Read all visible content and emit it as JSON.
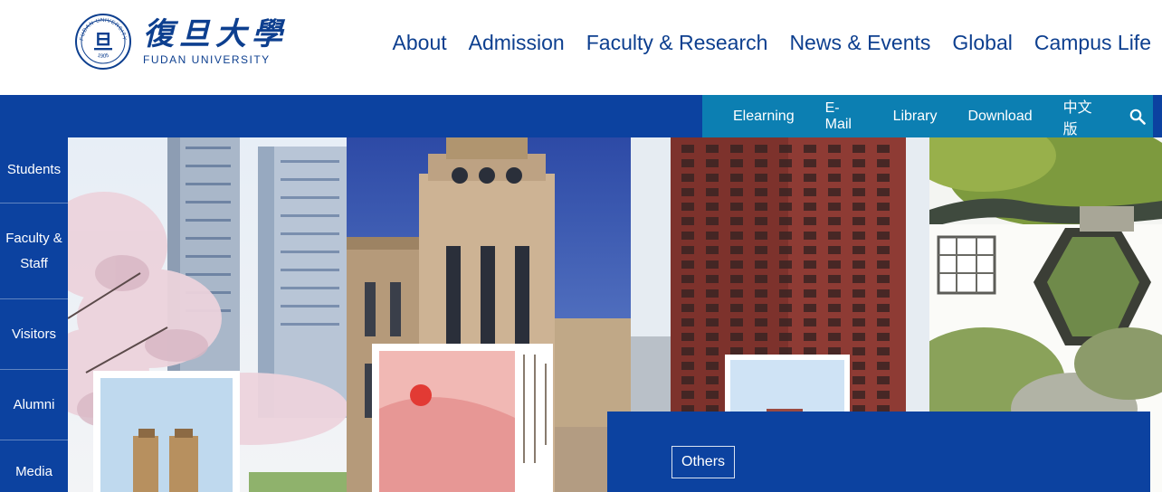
{
  "brand": {
    "name_cn": "復旦大學",
    "name_en": "FUDAN UNIVERSITY",
    "seal_text": "FUDAN UNIVERSITY",
    "seal_year": "1905",
    "seal_glyph": "旦",
    "color": "#0d3f8f"
  },
  "main_nav": [
    {
      "label": "About"
    },
    {
      "label": "Admission"
    },
    {
      "label": "Faculty & Research"
    },
    {
      "label": "News & Events"
    },
    {
      "label": "Global"
    },
    {
      "label": "Campus Life"
    }
  ],
  "utility_nav": {
    "items": [
      {
        "label": "Elearning"
      },
      {
        "label": "E-Mail"
      },
      {
        "label": "Library"
      },
      {
        "label": "Download"
      },
      {
        "label": "中文版"
      }
    ],
    "search_icon": "search-icon",
    "color": "#0c7fb2"
  },
  "side_nav": [
    {
      "label": "Students"
    },
    {
      "label": "Faculty &\nStaff"
    },
    {
      "label": "Visitors"
    },
    {
      "label": "Alumni"
    },
    {
      "label": "Media"
    }
  ],
  "feature": {
    "tag_label": "Others"
  },
  "colors": {
    "primary_blue": "#0c42a0",
    "utility_blue": "#0c7fb2"
  }
}
